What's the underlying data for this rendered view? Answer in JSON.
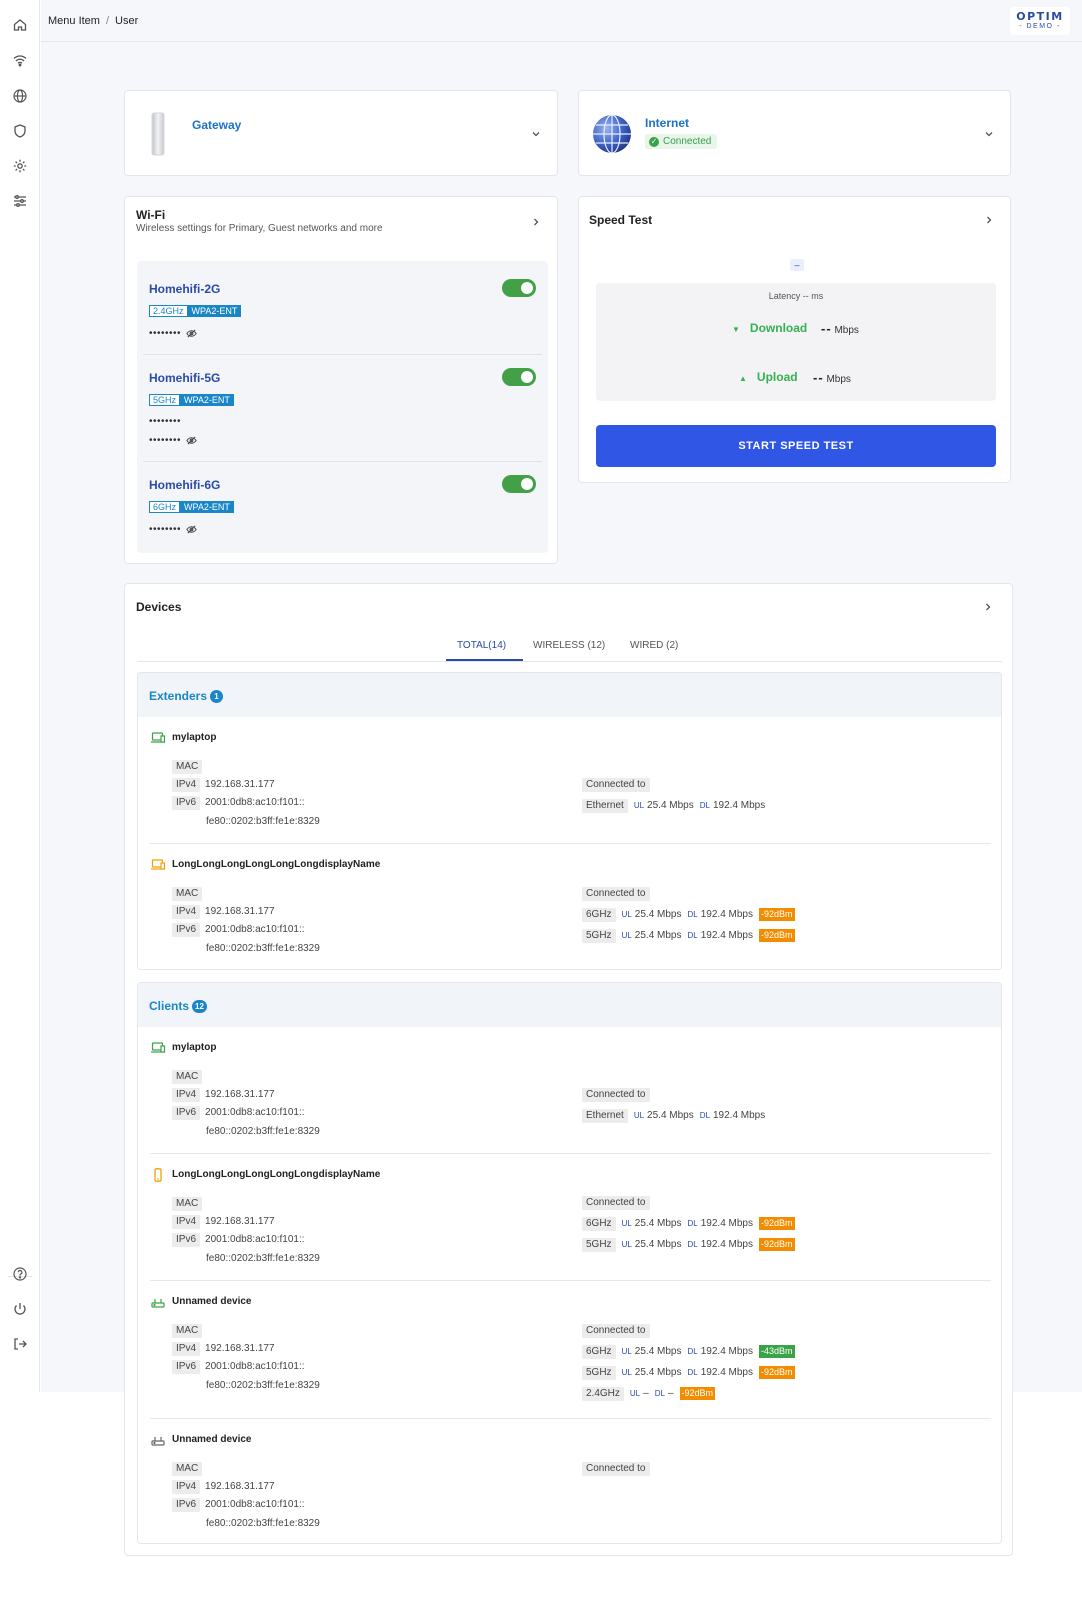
{
  "breadcrumb": {
    "item1": "Menu Item",
    "sep": "/",
    "item2": "User"
  },
  "logo": {
    "line1": "OPTIM",
    "line2": "- DEMO -"
  },
  "gateway": {
    "title": "Gateway"
  },
  "internet": {
    "title": "Internet",
    "status": "Connected"
  },
  "wifi": {
    "title": "Wi-Fi",
    "subtitle": "Wireless settings for Primary, Guest networks and more",
    "networks": [
      {
        "name": "Homehifi-2G",
        "band": "2.4GHz",
        "security": "WPA2-ENT",
        "password": "••••••••",
        "extra": ""
      },
      {
        "name": "Homehifi-5G",
        "band": "5GHz",
        "security": "WPA2-ENT",
        "password": "••••••••",
        "extra": "••••••••"
      },
      {
        "name": "Homehifi-6G",
        "band": "6GHz",
        "security": "WPA2-ENT",
        "password": "••••••••",
        "extra": ""
      }
    ]
  },
  "speedtest": {
    "title": "Speed Test",
    "dash": "–",
    "latency": "Latency -- ms",
    "download_label": "Download",
    "upload_label": "Upload",
    "download_value": "--",
    "upload_value": "--",
    "unit": "Mbps",
    "button": "START SPEED TEST"
  },
  "devices": {
    "title": "Devices",
    "tabs": [
      "TOTAL(14)",
      "WIRELESS (12)",
      "WIRED (2)"
    ],
    "labels": {
      "mac": "MAC",
      "ipv4": "IPv4",
      "ipv6": "IPv6",
      "connected_to": "Connected to",
      "ul": "UL",
      "dl": "DL"
    },
    "extenders": {
      "title": "Extenders",
      "count": "1",
      "items": [
        {
          "name": "mylaptop",
          "ipv4": "192.168.31.177",
          "ipv6": "2001:0db8:ac10:f101::",
          "ipv6b": "fe80::0202:b3ff:fe1e:8329",
          "links": [
            {
              "if": "Ethernet",
              "ul": "25.4 Mbps",
              "dl": "192.4 Mbps",
              "rssi": ""
            }
          ]
        },
        {
          "name": "LongLongLongLongLongLongdisplayName",
          "ipv4": "192.168.31.177",
          "ipv6": "2001:0db8:ac10:f101::",
          "ipv6b": "fe80::0202:b3ff:fe1e:8329",
          "links": [
            {
              "if": "6GHz",
              "ul": "25.4 Mbps",
              "dl": "192.4 Mbps",
              "rssi": "-92dBm"
            },
            {
              "if": "5GHz",
              "ul": "25.4 Mbps",
              "dl": "192.4 Mbps",
              "rssi": "-92dBm"
            }
          ]
        }
      ]
    },
    "clients": {
      "title": "Clients",
      "count": "12",
      "items": [
        {
          "name": "mylaptop",
          "ipv4": "192.168.31.177",
          "ipv6": "2001:0db8:ac10:f101::",
          "ipv6b": "fe80::0202:b3ff:fe1e:8329",
          "links": [
            {
              "if": "Ethernet",
              "ul": "25.4 Mbps",
              "dl": "192.4 Mbps",
              "rssi": ""
            }
          ]
        },
        {
          "name": "LongLongLongLongLongLongdisplayName",
          "ipv4": "192.168.31.177",
          "ipv6": "2001:0db8:ac10:f101::",
          "ipv6b": "fe80::0202:b3ff:fe1e:8329",
          "links": [
            {
              "if": "6GHz",
              "ul": "25.4 Mbps",
              "dl": "192.4 Mbps",
              "rssi": "-92dBm"
            },
            {
              "if": "5GHz",
              "ul": "25.4 Mbps",
              "dl": "192.4 Mbps",
              "rssi": "-92dBm"
            }
          ]
        },
        {
          "name": "Unnamed device",
          "ipv4": "192.168.31.177",
          "ipv6": "2001:0db8:ac10:f101::",
          "ipv6b": "fe80::0202:b3ff:fe1e:8329",
          "links": [
            {
              "if": "6GHz",
              "ul": "25.4 Mbps",
              "dl": "192.4 Mbps",
              "rssi": "-43dBm"
            },
            {
              "if": "5GHz",
              "ul": "25.4 Mbps",
              "dl": "192.4 Mbps",
              "rssi": "-92dBm"
            },
            {
              "if": "2.4GHz",
              "ul": "–",
              "dl": "–",
              "rssi": "-92dBm"
            }
          ]
        },
        {
          "name": "Unnamed device",
          "ipv4": "192.168.31.177",
          "ipv6": "2001:0db8:ac10:f101::",
          "ipv6b": "fe80::0202:b3ff:fe1e:8329",
          "links": []
        }
      ]
    }
  },
  "colors": {
    "accent": "#2f56e4",
    "link": "#1a86c8",
    "ok": "#3aa348",
    "warn": "#f28c00"
  }
}
